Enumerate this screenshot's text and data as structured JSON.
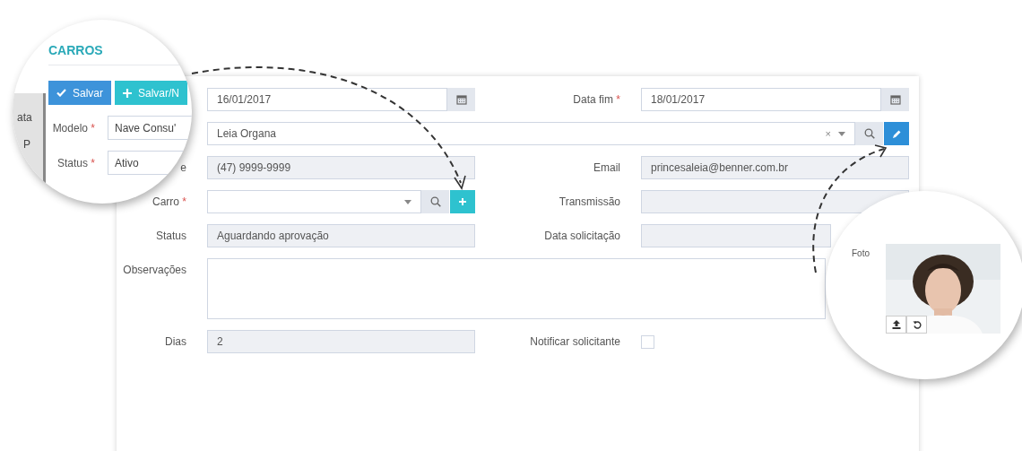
{
  "zoom_left": {
    "title": "CARROS",
    "background_texts": [
      "ata",
      "P"
    ],
    "buttons": [
      {
        "kind": "save",
        "label": "Salvar"
      },
      {
        "kind": "save_new",
        "label": "Salvar/N"
      }
    ],
    "fields": [
      {
        "label": "Modelo",
        "mark": "*",
        "value": "Nave Consu'"
      },
      {
        "label": "Status",
        "mark": "*",
        "value": "Ativo"
      }
    ]
  },
  "form": {
    "rows": [
      {
        "fields": [
          {
            "kind": "date",
            "value": "16/01/2017",
            "readonly": false
          },
          {
            "kind": "date",
            "label": "Data fim",
            "mark": "*",
            "value": "18/01/2017",
            "readonly": false
          }
        ]
      },
      {
        "fields": [
          {
            "kind": "lookup_edit",
            "value": "Leia Organa",
            "clear": "×",
            "readonly": false
          }
        ]
      },
      {
        "fields": [
          {
            "kind": "text",
            "label": "e",
            "value": "(47) 9999-9999",
            "readonly": true
          },
          {
            "kind": "text",
            "label": "Email",
            "value": "princesaleia@benner.com.br",
            "readonly": true
          }
        ]
      },
      {
        "fields": [
          {
            "kind": "lookup_add",
            "label": "Carro",
            "mark": "*",
            "readonly": false
          },
          {
            "kind": "text",
            "label": "Transmissão",
            "readonly": true
          }
        ]
      },
      {
        "fields": [
          {
            "kind": "text",
            "label": "Status",
            "value": "Aguardando aprovação",
            "readonly": true
          },
          {
            "kind": "text",
            "label": "Data solicitação",
            "readonly": true
          }
        ]
      },
      {
        "fields": [
          {
            "kind": "textarea",
            "label": "Observações",
            "readonly": false
          }
        ]
      },
      {
        "fields": [
          {
            "kind": "text",
            "label": "Dias",
            "value": "2",
            "readonly": true
          },
          {
            "kind": "checkbox",
            "label": "Notificar solicitante",
            "checked": false
          }
        ]
      }
    ]
  },
  "zoom_right": {
    "label": "Foto"
  }
}
